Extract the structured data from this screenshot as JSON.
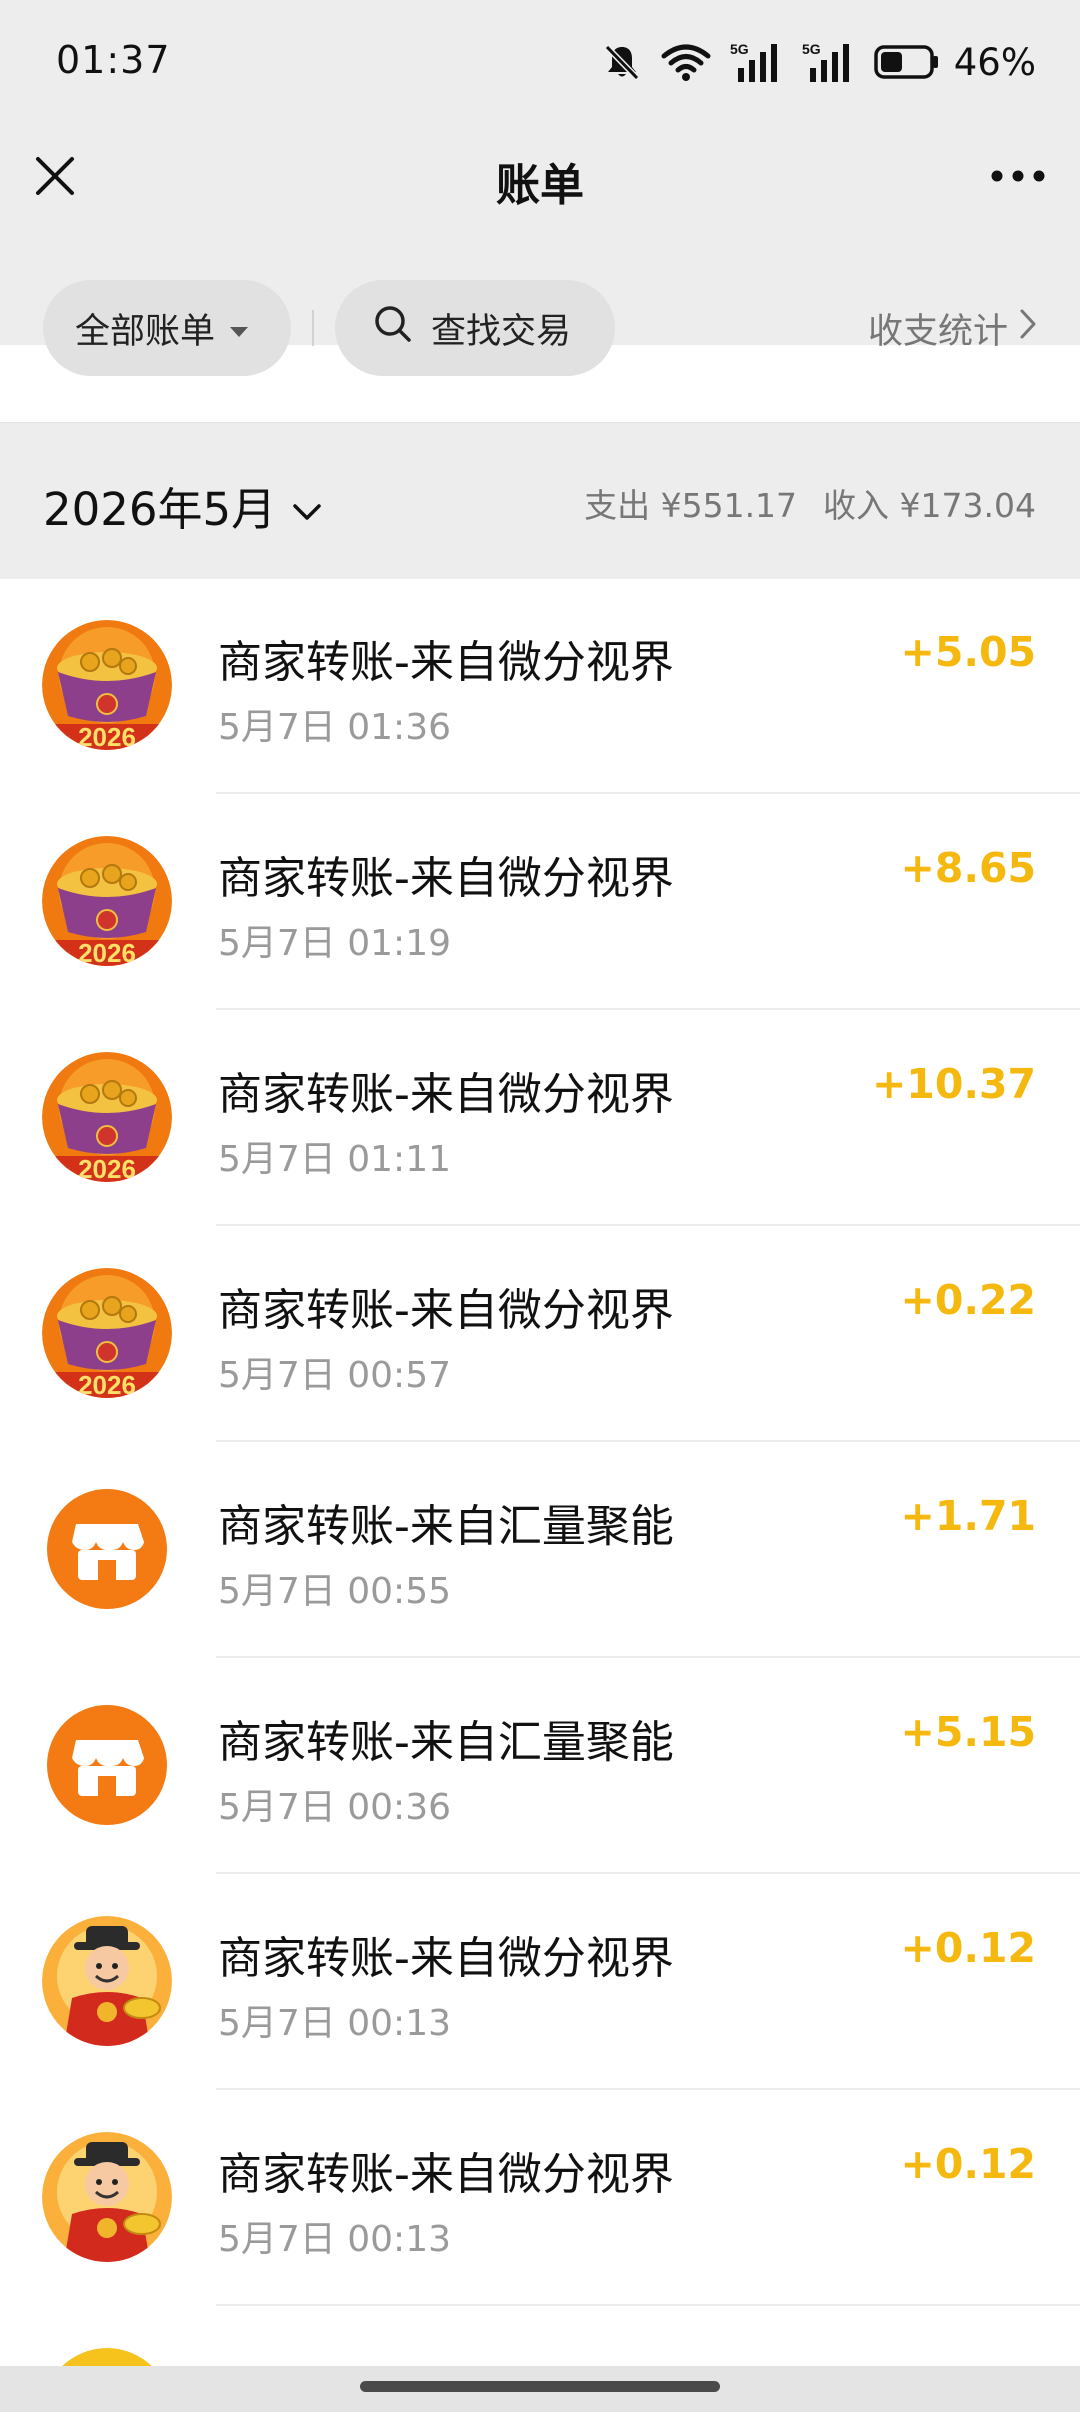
{
  "status_bar": {
    "time": "01:37",
    "battery": "46%",
    "network_1": "5G",
    "network_2": "5G",
    "icons": [
      "bell-off-icon",
      "wifi-icon",
      "signal-5g-icon",
      "signal-5g-icon",
      "battery-icon"
    ],
    "battery_level": 0.46
  },
  "nav": {
    "title": "账单",
    "close_icon": "close-icon",
    "more_icon": "more-icon"
  },
  "filters": {
    "all_bills_label": "全部账单",
    "search_label": "查找交易",
    "stats_label": "收支统计"
  },
  "month": {
    "label": "2026年5月",
    "expense": "支出 ¥551.17",
    "income": "收入 ¥173.04"
  },
  "colors": {
    "income_amount": "#f5b80e",
    "background_gray": "#ededed",
    "merchant_orange": "#f47a14"
  },
  "transactions": [
    {
      "title": "商家转账-来自微分视界",
      "time": "5月7日 01:36",
      "amount": "+5.05",
      "avatar": "gold-bowl-2026-icon"
    },
    {
      "title": "商家转账-来自微分视界",
      "time": "5月7日 01:19",
      "amount": "+8.65",
      "avatar": "gold-bowl-2026-icon"
    },
    {
      "title": "商家转账-来自微分视界",
      "time": "5月7日 01:11",
      "amount": "+10.37",
      "avatar": "gold-bowl-2026-icon"
    },
    {
      "title": "商家转账-来自微分视界",
      "time": "5月7日 00:57",
      "amount": "+0.22",
      "avatar": "gold-bowl-2026-icon"
    },
    {
      "title": "商家转账-来自汇量聚能",
      "time": "5月7日 00:55",
      "amount": "+1.71",
      "avatar": "shop-icon"
    },
    {
      "title": "商家转账-来自汇量聚能",
      "time": "5月7日 00:36",
      "amount": "+5.15",
      "avatar": "shop-icon"
    },
    {
      "title": "商家转账-来自微分视界",
      "time": "5月7日 00:13",
      "amount": "+0.12",
      "avatar": "fortune-god-icon"
    },
    {
      "title": "商家转账-来自微分视界",
      "time": "5月7日 00:13",
      "amount": "+0.12",
      "avatar": "fortune-god-icon"
    }
  ]
}
